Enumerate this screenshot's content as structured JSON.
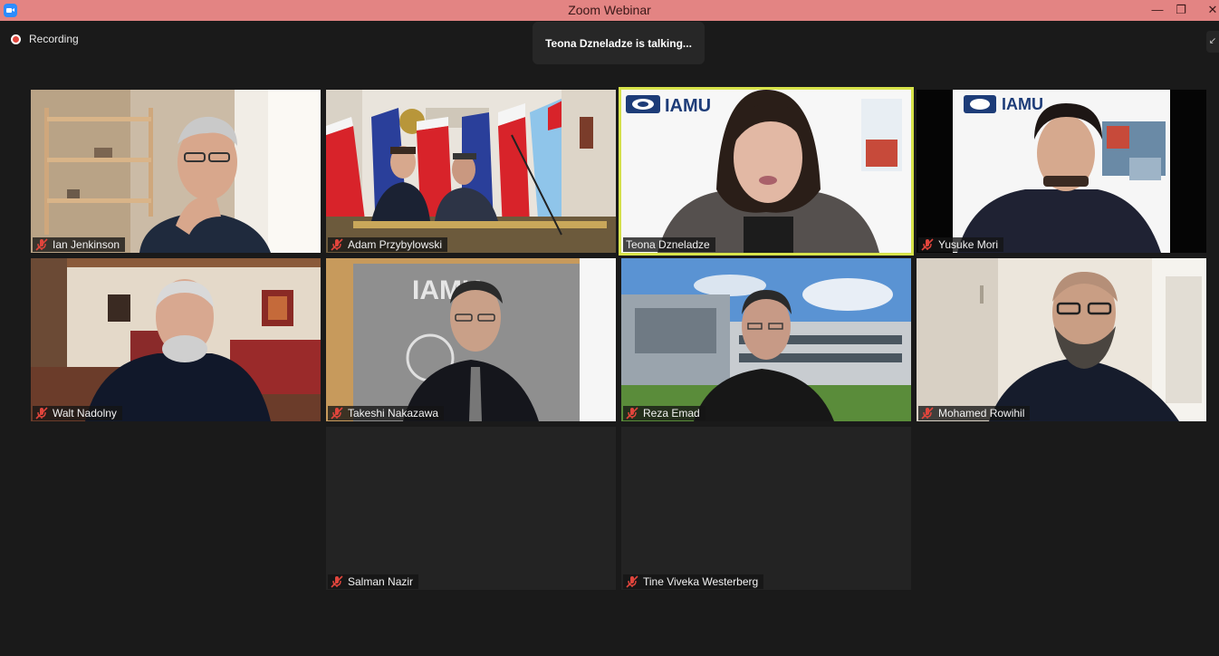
{
  "window": {
    "title": "Zoom Webinar",
    "icon": "zoom-app-icon"
  },
  "controls": {
    "minimize": "—",
    "maximize": "❐",
    "close": "✕"
  },
  "recording": {
    "label": "Recording",
    "icon": "recording-dot-icon"
  },
  "toast": {
    "text": "Teona Dzneladze is talking..."
  },
  "exit_fullscreen_icon": "↙",
  "colors": {
    "titlebar": "#e38483",
    "active_speaker_border": "#d7e34a",
    "muted_mic": "#e0453c",
    "background": "#1a1a1a"
  },
  "participants": [
    {
      "name": "Ian Jenkinson",
      "muted": true,
      "active": false,
      "video": true
    },
    {
      "name": "Adam Przybylowski",
      "muted": true,
      "active": false,
      "video": true
    },
    {
      "name": "Teona Dzneladze",
      "muted": false,
      "active": true,
      "video": true,
      "background_text": "IAMU"
    },
    {
      "name": "Yusuke Mori",
      "muted": true,
      "active": false,
      "video": true,
      "background_text": "IAMU"
    },
    {
      "name": "Walt Nadolny",
      "muted": true,
      "active": false,
      "video": true
    },
    {
      "name": "Takeshi Nakazawa",
      "muted": true,
      "active": false,
      "video": true,
      "background_text": "IAMU"
    },
    {
      "name": "Reza Emad",
      "muted": true,
      "active": false,
      "video": true
    },
    {
      "name": "Mohamed Rowihil",
      "muted": true,
      "active": false,
      "video": true
    },
    {
      "name": "Salman Nazir",
      "muted": true,
      "active": false,
      "video": false
    },
    {
      "name": "Tine Viveka Westerberg",
      "muted": true,
      "active": false,
      "video": false
    }
  ]
}
